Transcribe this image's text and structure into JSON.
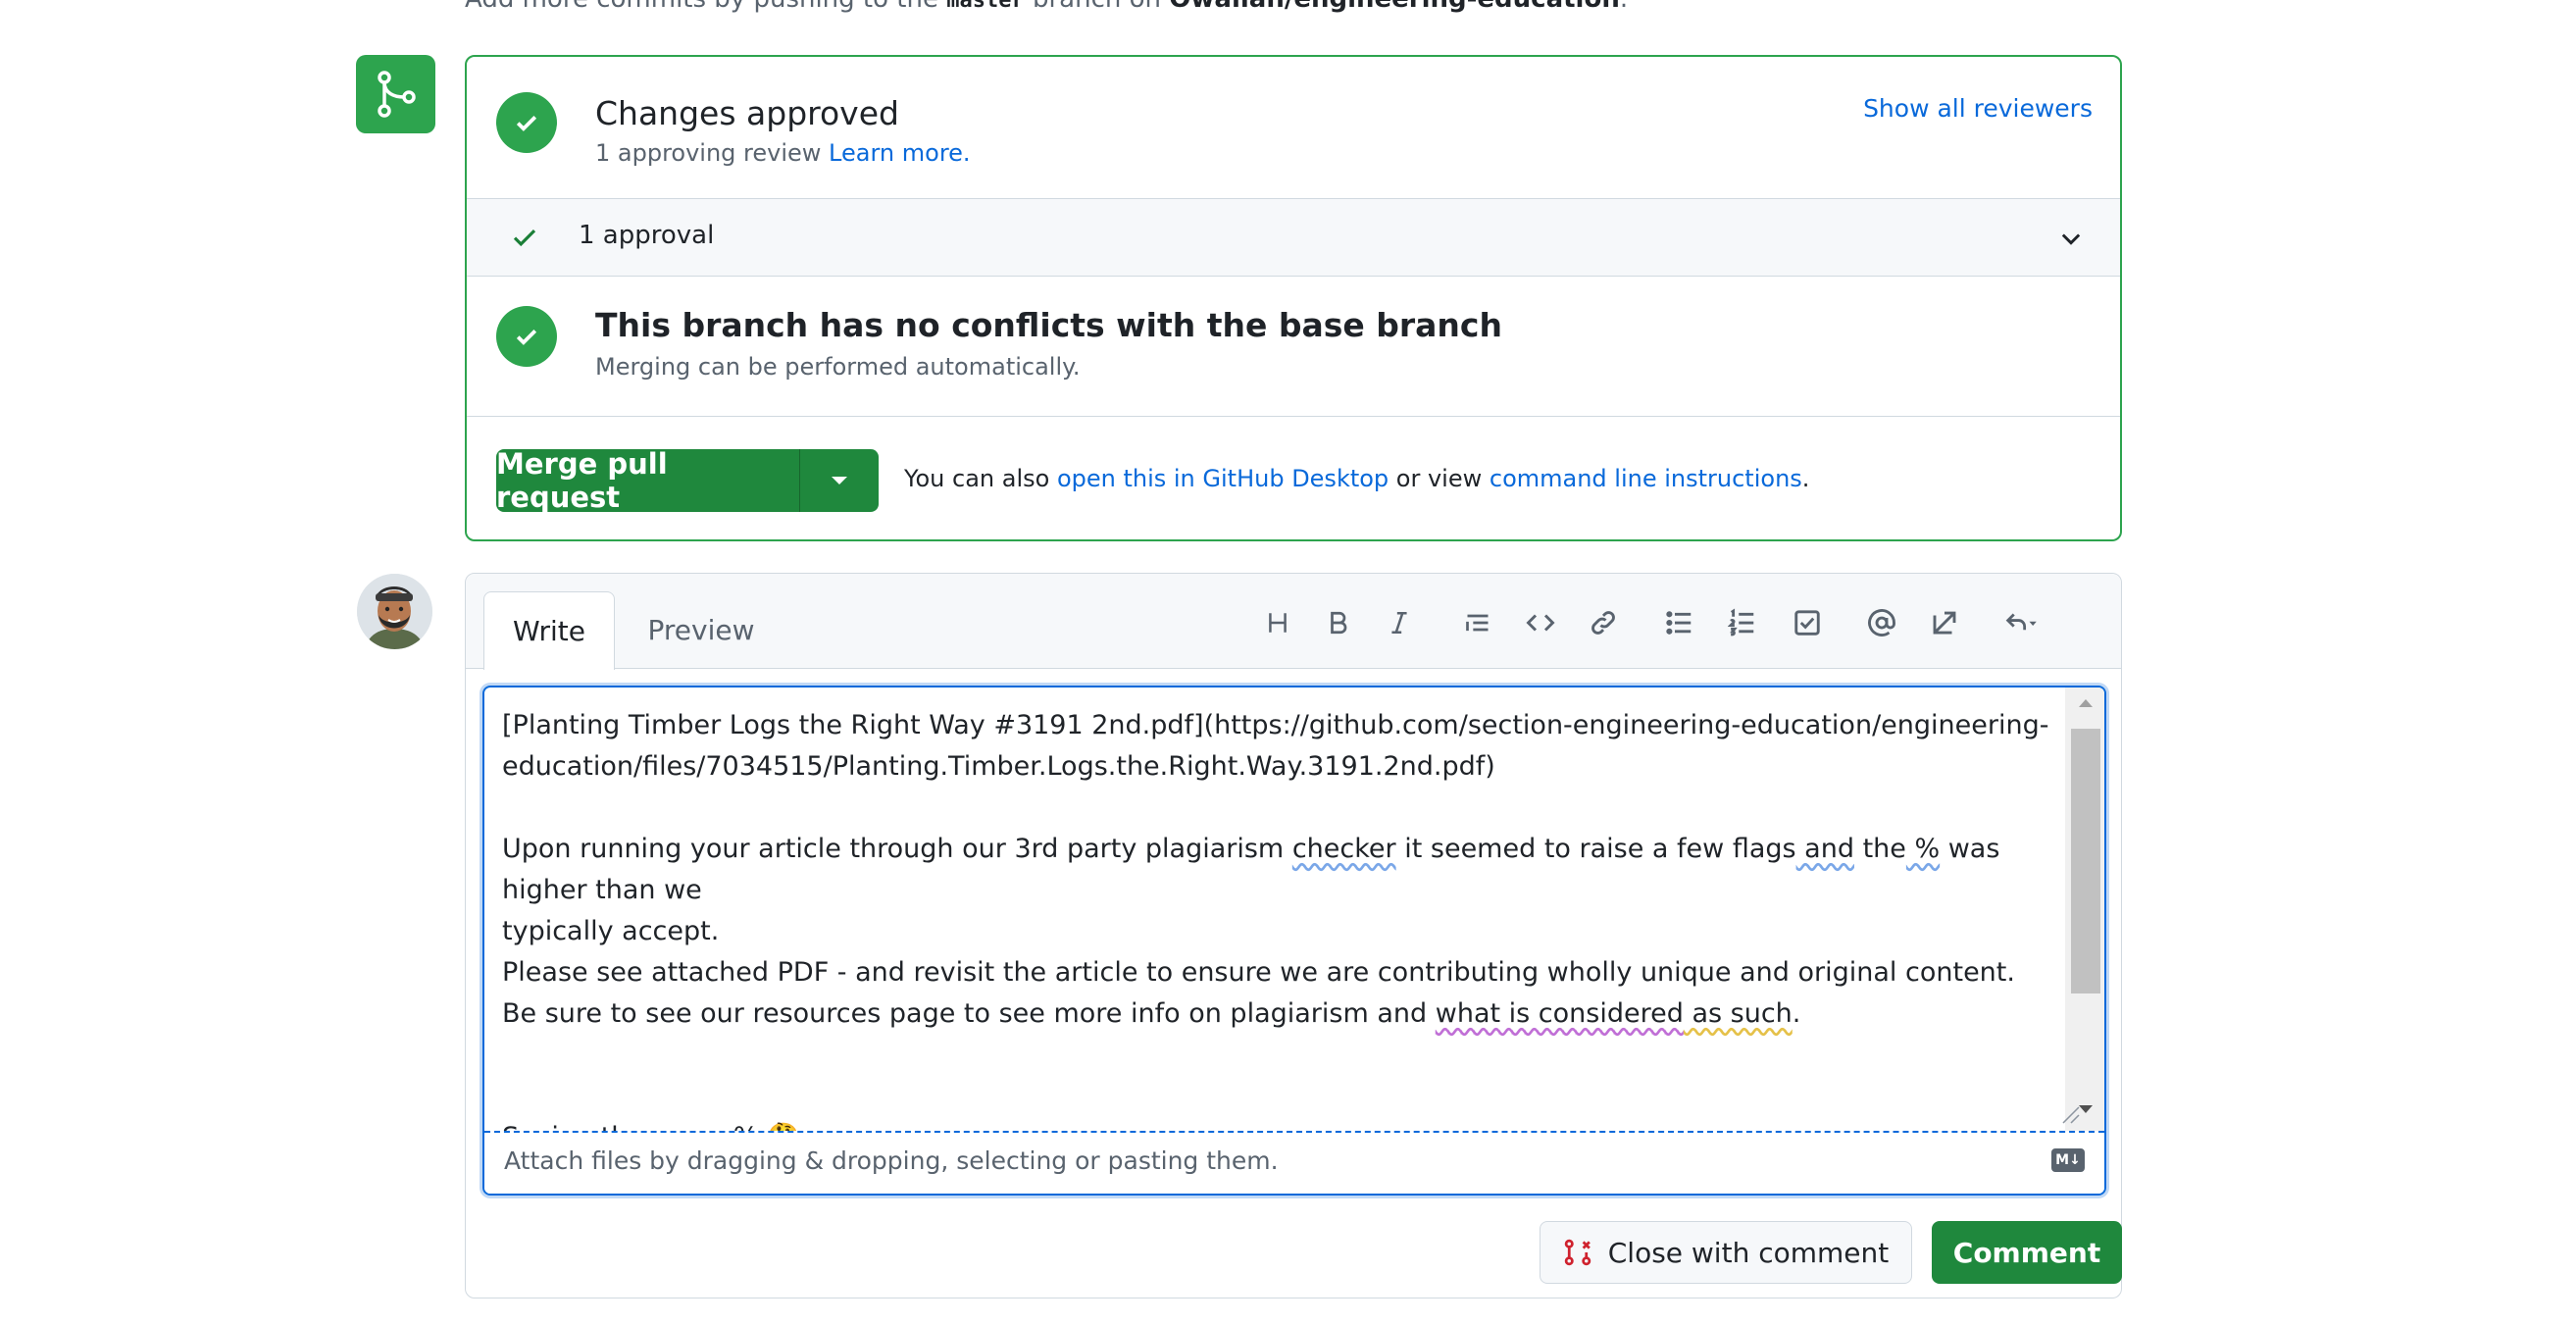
{
  "hint": {
    "prefix": "Add more commits by pushing to the ",
    "branch": "master",
    "middle": " branch on ",
    "repo": "Owallah/engineering-education",
    "suffix": "."
  },
  "approval": {
    "title": "Changes approved",
    "subtitle": "1 approving review ",
    "learn_more": "Learn more.",
    "show_reviewers": "Show all reviewers",
    "approvals_label": "1 approval"
  },
  "conflicts": {
    "title": "This branch has no conflicts with the base branch",
    "subtitle": "Merging can be performed automatically."
  },
  "merge": {
    "button_label": "Merge pull request",
    "also_prefix": "You can also ",
    "desktop_link": "open this in GitHub Desktop",
    "or_view": " or view ",
    "cli_link": "command line instructions",
    "suffix": "."
  },
  "comment": {
    "tabs": [
      "Write",
      "Preview"
    ],
    "toolbar_icons": [
      "heading-icon",
      "bold-icon",
      "italic-icon",
      "quote-icon",
      "code-icon",
      "link-icon",
      "bulleted-list-icon",
      "numbered-list-icon",
      "task-list-icon",
      "mention-icon",
      "reference-icon",
      "undo-icon"
    ],
    "text": {
      "line1": "[Planting Timber Logs the Right Way #3191 2nd.pdf](https://github.com/section-engineering-education/engineering-",
      "line2": "education/files/7034515/Planting.Timber.Logs.the.Right.Way.3191.2nd.pdf)",
      "p1_a": "Upon running your article through our 3rd party plagiarism ",
      "p1_checker": "checker",
      "p1_b": " it seemed to raise a few flags",
      "p1_and": " and",
      "p1_c": " the",
      "p1_pct": " %",
      "p1_d": " was higher than we",
      "p1_e": "typically accept.",
      "p2": "Please see attached PDF - and revisit the article to ensure we are contributing wholly unique and original content.",
      "p3_a": "Be sure to see our resources page to see more info on plagiarism and ",
      "p3_what": "what is considered",
      "p3_as": " as such",
      "p3_end": ".",
      "p4_a": "Seeing the same",
      "p4_pct": " %",
      "p4_emoji": "🤔"
    },
    "attach_hint": "Attach files by dragging & dropping, selecting or pasting them.",
    "markdown_badge": "M↓",
    "close_button": "Close with comment",
    "comment_button": "Comment"
  },
  "colors": {
    "success": "#2da44e",
    "primary_button": "#1f883d",
    "link": "#0969da",
    "muted": "#59636e"
  }
}
